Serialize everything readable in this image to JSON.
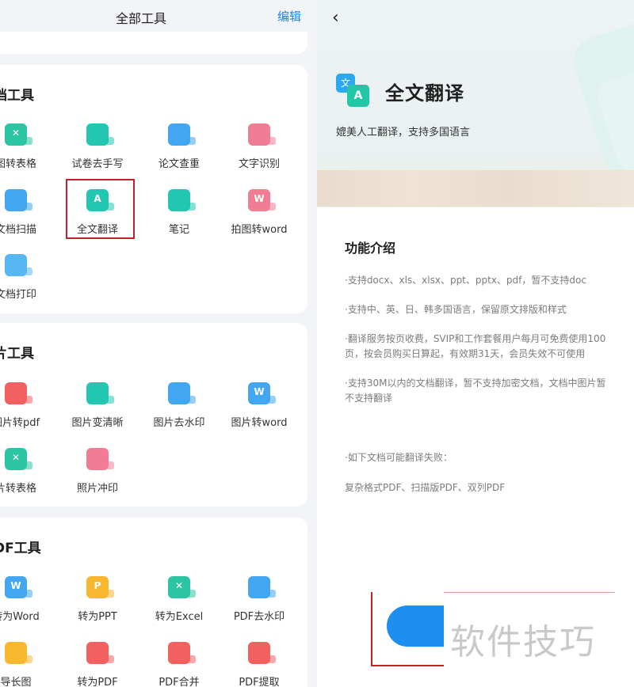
{
  "left": {
    "header": {
      "title": "全部工具",
      "edit_label": "编辑"
    },
    "doc_tools": {
      "title": "档工具",
      "items": [
        {
          "label": "图转表格",
          "icon": "table-icon",
          "glyph": "✕",
          "color": "green"
        },
        {
          "label": "试卷去手写",
          "icon": "pen-icon",
          "glyph": "",
          "color": "teal"
        },
        {
          "label": "论文查重",
          "icon": "search-doc-icon",
          "glyph": "",
          "color": "blue"
        },
        {
          "label": "文字识别",
          "icon": "ocr-icon",
          "glyph": "",
          "color": "pink"
        },
        {
          "label": "文档扫描",
          "icon": "scan-icon",
          "glyph": "",
          "color": "blue"
        },
        {
          "label": "全文翻译",
          "icon": "translate-icon",
          "glyph": "A",
          "color": "teal"
        },
        {
          "label": "笔记",
          "icon": "note-icon",
          "glyph": "",
          "color": "teal"
        },
        {
          "label": "拍图转word",
          "icon": "word-icon",
          "glyph": "W",
          "color": "pink"
        },
        {
          "label": "文档打印",
          "icon": "printer-icon",
          "glyph": "",
          "color": "sky"
        }
      ]
    },
    "image_tools": {
      "title": "片工具",
      "items": [
        {
          "label": "图片转pdf",
          "icon": "pdf-icon",
          "glyph": "",
          "color": "red"
        },
        {
          "label": "图片变清晰",
          "icon": "image-enhance-icon",
          "glyph": "",
          "color": "teal"
        },
        {
          "label": "图片去水印",
          "icon": "image-watermark-icon",
          "glyph": "",
          "color": "blue"
        },
        {
          "label": "图片转word",
          "icon": "word-icon",
          "glyph": "W",
          "color": "blue"
        },
        {
          "label": "片转表格",
          "icon": "table-icon",
          "glyph": "✕",
          "color": "green"
        },
        {
          "label": "照片冲印",
          "icon": "photo-print-icon",
          "glyph": "",
          "color": "pink"
        }
      ]
    },
    "pdf_tools": {
      "title": "DF工具",
      "items": [
        {
          "label": "转为Word",
          "icon": "word-icon",
          "glyph": "W",
          "color": "blue"
        },
        {
          "label": "转为PPT",
          "icon": "ppt-icon",
          "glyph": "P",
          "color": "yellow"
        },
        {
          "label": "转为Excel",
          "icon": "excel-icon",
          "glyph": "✕",
          "color": "green"
        },
        {
          "label": "PDF去水印",
          "icon": "pdf-watermark-icon",
          "glyph": "",
          "color": "blue"
        },
        {
          "label": "导长图",
          "icon": "long-image-icon",
          "glyph": "",
          "color": "yellow"
        },
        {
          "label": "转为PDF",
          "icon": "pdf-icon",
          "glyph": "",
          "color": "red"
        },
        {
          "label": "PDF合并",
          "icon": "pdf-merge-icon",
          "glyph": "",
          "color": "red"
        },
        {
          "label": "PDF提取",
          "icon": "pdf-extract-icon",
          "glyph": "",
          "color": "red"
        }
      ]
    }
  },
  "right": {
    "back_glyph": "‹",
    "app_icon_glyph_a": "文",
    "app_icon_glyph_b": "A",
    "title": "全文翻译",
    "subtitle": "媲美人工翻译，支持多国语言",
    "section_title": "功能介绍",
    "paragraphs": [
      "·支持docx、xls、xlsx、ppt、pptx、pdf，暂不支持doc",
      "·支持中、英、日、韩多国语言，保留原文排版和样式",
      "·翻译服务按页收费，SVIP和工作套餐用户每月可免费使用100",
      "页，按会员购买日算起，有效期31天，会员失效不可使用",
      "·支持30M以内的文档翻译，暂不支持加密文档，文档中图片暂",
      "不支持翻译",
      "·如下文档可能翻译失败：",
      "复杂格式PDF、扫描版PDF、双列PDF"
    ],
    "watermark": "软件技巧"
  }
}
